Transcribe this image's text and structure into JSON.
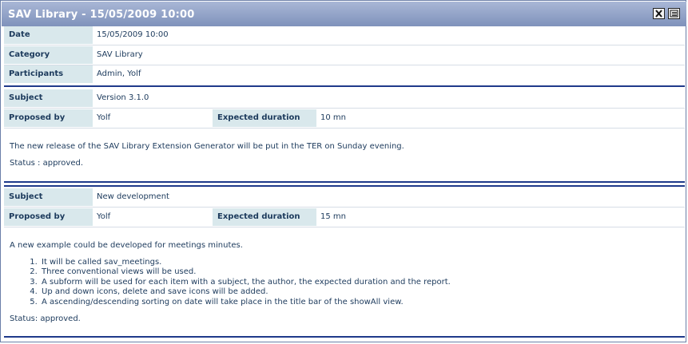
{
  "window": {
    "title": "SAV Library - 15/05/2009 10:00",
    "close_icon": "close-icon",
    "list_icon": "list-view-icon"
  },
  "meeting": {
    "date_label": "Date",
    "date_value": "15/05/2009 10:00",
    "category_label": "Category",
    "category_value": "SAV Library",
    "participants_label": "Participants",
    "participants_value": "Admin, Yolf"
  },
  "items": [
    {
      "subject_label": "Subject",
      "subject_value": "Version 3.1.0",
      "proposed_label": "Proposed by",
      "proposed_value": "Yolf",
      "duration_label": "Expected duration",
      "duration_value": "10 mn",
      "report_text": "The new release of the SAV Library Extension Generator will be put in the TER on Sunday evening.",
      "status_text": "Status : approved."
    },
    {
      "subject_label": "Subject",
      "subject_value": "New development",
      "proposed_label": "Proposed by",
      "proposed_value": "Yolf",
      "duration_label": "Expected duration",
      "duration_value": "15 mn",
      "report_text": "A new example could be developed for meetings minutes.",
      "report_list": [
        "It will be called sav_meetings.",
        "Three conventional views will be used.",
        "A subform will be used for each item with a subject, the author, the expected duration and the report.",
        "Up and down icons, delete and save icons will be added.",
        "A ascending/descending sorting on date will take place in the title bar of the showAll view."
      ],
      "status_text": "Status: approved."
    }
  ]
}
